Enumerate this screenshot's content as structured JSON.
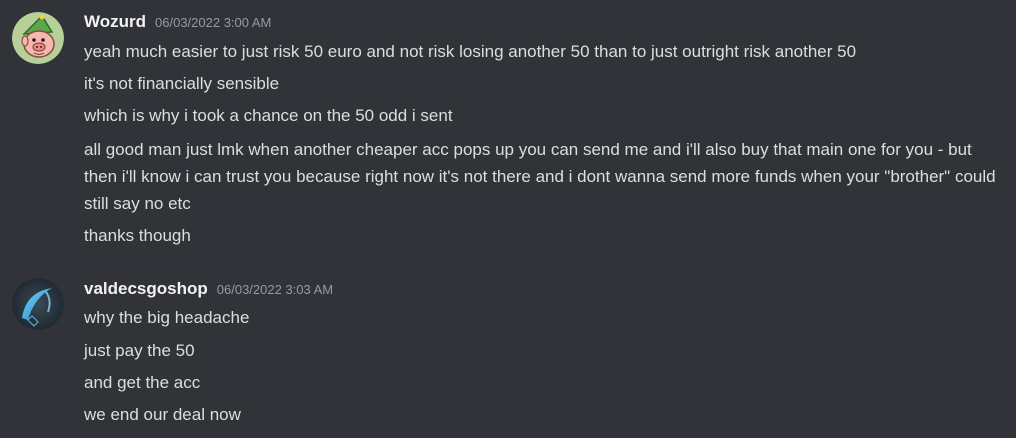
{
  "messages": [
    {
      "username": "Wozurd",
      "timestamp": "06/03/2022 3:00 AM",
      "avatar_icon": "elf-pig-avatar",
      "lines": [
        "yeah much easier to just risk 50 euro and not risk losing another 50 than to just outright risk another 50",
        "it's not financially sensible",
        "which is why i took a chance on the 50 odd i sent",
        "all good man just lmk when another cheaper acc pops up you can send me and i'll also buy that main one for you - but then i'll know i can trust you because right now it's not there and i dont wanna send more funds when your \"brother\" could still say no etc",
        "thanks though"
      ]
    },
    {
      "username": "valdecsgoshop",
      "timestamp": "06/03/2022 3:03 AM",
      "avatar_icon": "knife-avatar",
      "lines": [
        "why the big headache",
        "just pay the 50",
        "and get the acc",
        "we end our deal now"
      ]
    }
  ],
  "colors": {
    "background": "#313338",
    "text": "#dbdee1",
    "username": "#f2f3f5",
    "timestamp": "#949ba4"
  }
}
